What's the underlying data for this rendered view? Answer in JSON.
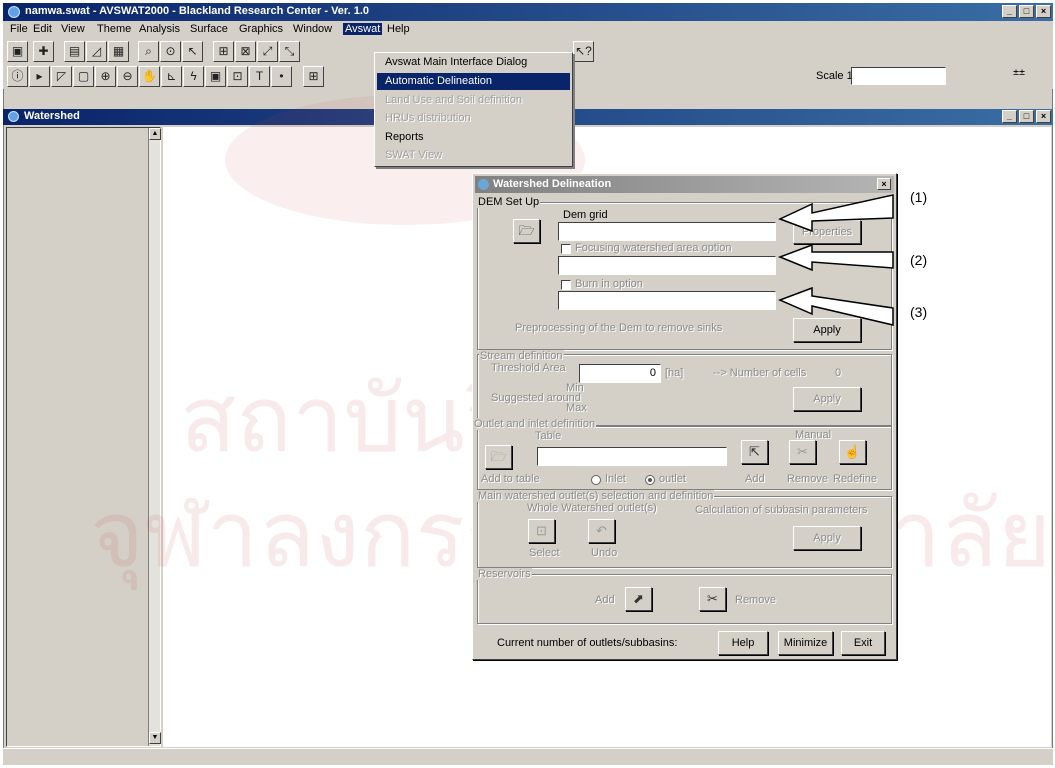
{
  "app": {
    "title": "namwa.swat - AVSWAT2000 - Blackland Research Center - Ver. 1.0",
    "window_buttons": [
      "_",
      "□",
      "×"
    ]
  },
  "menubar": {
    "items": [
      "File",
      "Edit",
      "View",
      "Theme",
      "Analysis",
      "Surface",
      "Graphics",
      "Window",
      "Avswat",
      "Help"
    ],
    "active": "Avswat"
  },
  "avswat_menu": {
    "items": [
      {
        "label": "Avswat Main Interface Dialog",
        "state": "normal"
      },
      {
        "label": "Automatic Delineation",
        "state": "selected"
      },
      {
        "label": "Land Use and Soil definition",
        "state": "disabled"
      },
      {
        "label": "HRUs distribution",
        "state": "disabled"
      },
      {
        "label": "Reports",
        "state": "normal"
      },
      {
        "label": "SWAT View",
        "state": "disabled"
      }
    ]
  },
  "toolbar2": {
    "scale_label": "Scale 1:",
    "scale_value": "",
    "coords_icon": "±±"
  },
  "document": {
    "title": "Watershed"
  },
  "dialog": {
    "title": "Watershed Delineation",
    "close": "×",
    "dem_setup": {
      "group_label": "DEM Set Up",
      "dem_grid_label": "Dem grid",
      "dem_grid_value": "",
      "properties_button": "Properties",
      "focusing_option_label": "Focusing watershed area option",
      "focusing_value": "",
      "burn_in_label": "Burn in option",
      "burn_in_value": "",
      "preprocessing_label": "Preprocessing of the Dem to remove sinks",
      "apply_button": "Apply"
    },
    "stream_definition": {
      "group_label": "Stream definition",
      "threshold_label": "Threshold Area",
      "threshold_value": "0",
      "unit": "[ha]",
      "cells_label": "--> Number of cells",
      "cells_value": "0",
      "min_label": "Min",
      "suggested_label": "Suggested around",
      "max_label": "Max",
      "apply_button": "Apply"
    },
    "outlet_definition": {
      "group_label": "Outlet and inlet definition",
      "table_label": "Table",
      "table_value": "",
      "add_to_table_label": "Add to table",
      "inlet_label": "Inlet",
      "outlet_label": "outlet",
      "selected": "outlet",
      "manual_label": "Manual",
      "add_label": "Add",
      "remove_label": "Remove",
      "redefine_label": "Redefine"
    },
    "main_outlet": {
      "group_label": "Main watershed outlet(s) selection and definition",
      "whole_label": "Whole Watershed outlet(s)",
      "select_label": "Select",
      "undo_label": "Undo",
      "calc_label": "Calculation of subbasin parameters",
      "calc_button": "Apply"
    },
    "reservoirs": {
      "group_label": "Reservoirs",
      "add_label": "Add",
      "remove_label": "Remove"
    },
    "footer": {
      "current_label": "Current number of outlets/subbasins:",
      "help_button": "Help",
      "minimize_button": "Minimize",
      "exit_button": "Exit"
    }
  },
  "annotations": [
    "(1)",
    "(2)",
    "(3)"
  ],
  "watermark": {
    "line1": "สถาบันวิทยบริการ",
    "line2": "จุฬาลงกรณ์มหาวิทยาลัย"
  },
  "colors": {
    "titlebar": "#0a246a",
    "selection": "#0a246a",
    "face": "#d4d0c8",
    "watermark": "#be2d2d"
  }
}
